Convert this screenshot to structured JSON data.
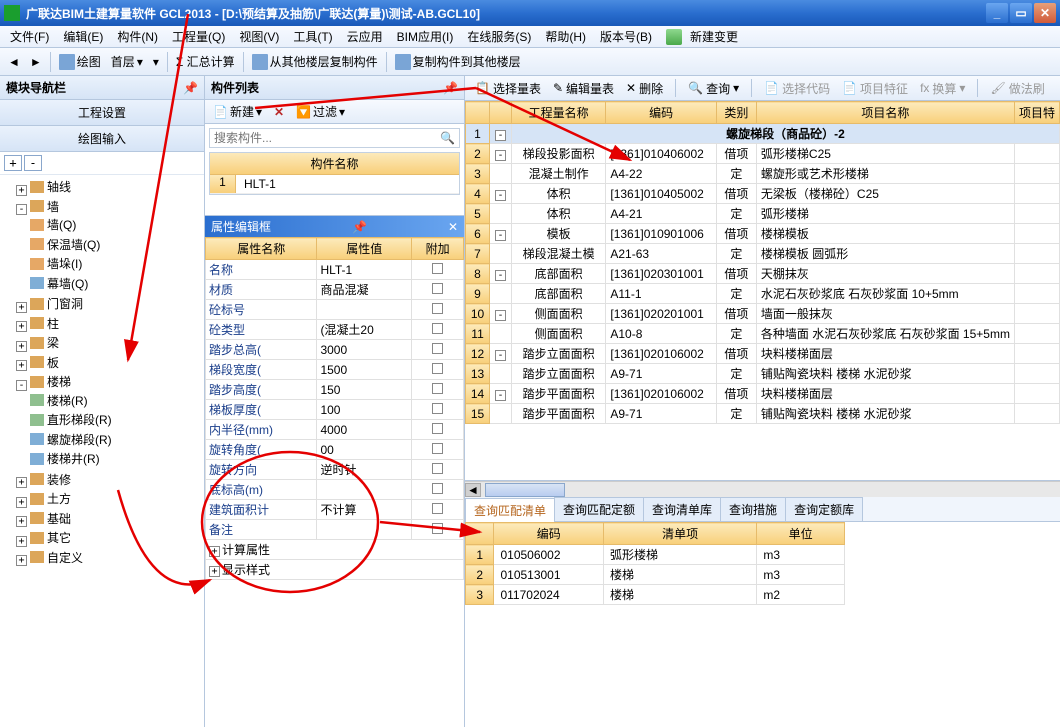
{
  "window": {
    "title": "广联达BIM土建算量软件 GCL2013 - [D:\\预结算及抽筋\\广联达(算量)\\测试-AB.GCL10]"
  },
  "menus": [
    "文件(F)",
    "编辑(E)",
    "构件(N)",
    "工程量(Q)",
    "视图(V)",
    "工具(T)",
    "云应用",
    "BIM应用(I)",
    "在线服务(S)",
    "帮助(H)",
    "版本号(B)"
  ],
  "menu_extra": "新建变更",
  "toolbar": {
    "draw": "绘图",
    "layer": "首层",
    "sum": "Σ 汇总计算",
    "copy_from": "从其他楼层复制构件",
    "copy_to": "复制构件到其他楼层"
  },
  "left": {
    "title": "模块导航栏",
    "acc1": "工程设置",
    "acc2": "绘图输入",
    "tree": {
      "axis": "轴线",
      "wall": "墙",
      "wall_q": "墙(Q)",
      "insu": "保温墙(Q)",
      "pier": "墙垛(I)",
      "curtain": "幕墙(Q)",
      "opening": "门窗洞",
      "col": "柱",
      "beam": "梁",
      "slab": "板",
      "stair": "楼梯",
      "stair_r": "楼梯(R)",
      "straight": "直形梯段(R)",
      "spiral": "螺旋梯段(R)",
      "well": "楼梯井(R)",
      "deco": "装修",
      "earth": "土方",
      "found": "基础",
      "other": "其它",
      "custom": "自定义"
    }
  },
  "mid": {
    "title": "构件列表",
    "new": "新建",
    "filter": "过滤",
    "search_ph": "搜索构件...",
    "col_name": "构件名称",
    "item1": "HLT-1",
    "prop_title": "属性编辑框",
    "prop_cols": {
      "name": "属性名称",
      "val": "属性值",
      "ext": "附加"
    },
    "rows": [
      {
        "n": "名称",
        "v": "HLT-1"
      },
      {
        "n": "材质",
        "v": "商品混凝"
      },
      {
        "n": "砼标号",
        "v": ""
      },
      {
        "n": "砼类型",
        "v": "(混凝土20"
      },
      {
        "n": "踏步总高(",
        "v": "3000"
      },
      {
        "n": "梯段宽度(",
        "v": "1500"
      },
      {
        "n": "踏步高度(",
        "v": "150"
      },
      {
        "n": "梯板厚度(",
        "v": "100"
      },
      {
        "n": "内半径(mm)",
        "v": "4000"
      },
      {
        "n": "旋转角度(",
        "v": "00"
      },
      {
        "n": "旋转方向",
        "v": "逆时针"
      },
      {
        "n": "底标高(m)",
        "v": ""
      },
      {
        "n": "建筑面积计",
        "v": "不计算"
      },
      {
        "n": "备注",
        "v": ""
      }
    ],
    "calc_prop": "计算属性",
    "disp_style": "显示样式"
  },
  "right": {
    "tb": {
      "sel": "选择量表",
      "edit": "编辑量表",
      "del": "删除",
      "query": "查询",
      "code": "选择代码",
      "feat": "项目特征",
      "convert": "换算",
      "brush": "做法刷"
    },
    "cols": {
      "name": "工程量名称",
      "code": "编码",
      "cat": "类别",
      "proj": "项目名称",
      "proj2": "项目特"
    },
    "rows": [
      {
        "n": "1",
        "pm": "-",
        "name": "螺旋梯段（商品砼）-2",
        "hl": true,
        "span": true
      },
      {
        "n": "2",
        "pm": "-",
        "name": "梯段投影面积",
        "code": "[1361]010406002",
        "cat": "借项",
        "proj": "弧形楼梯C25"
      },
      {
        "n": "3",
        "name": "混凝土制作",
        "code": "A4-22",
        "cat": "定",
        "proj": "螺旋形或艺术形楼梯"
      },
      {
        "n": "4",
        "pm": "-",
        "name": "体积",
        "code": "[1361]010405002",
        "cat": "借项",
        "proj": "无梁板（楼梯砼）C25"
      },
      {
        "n": "5",
        "name": "体积",
        "code": "A4-21",
        "cat": "定",
        "proj": "弧形楼梯"
      },
      {
        "n": "6",
        "pm": "-",
        "name": "模板",
        "code": "[1361]010901006",
        "cat": "借项",
        "proj": "楼梯模板"
      },
      {
        "n": "7",
        "name": "梯段混凝土模",
        "code": "A21-63",
        "cat": "定",
        "proj": "楼梯模板 圆弧形"
      },
      {
        "n": "8",
        "pm": "-",
        "name": "底部面积",
        "code": "[1361]020301001",
        "cat": "借项",
        "proj": "天棚抹灰"
      },
      {
        "n": "9",
        "name": "底部面积",
        "code": "A11-1",
        "cat": "定",
        "proj": "水泥石灰砂浆底 石灰砂浆面 10+5mm"
      },
      {
        "n": "10",
        "pm": "-",
        "name": "侧面面积",
        "code": "[1361]020201001",
        "cat": "借项",
        "proj": "墙面一般抹灰"
      },
      {
        "n": "11",
        "name": "侧面面积",
        "code": "A10-8",
        "cat": "定",
        "proj": "各种墙面 水泥石灰砂浆底 石灰砂浆面 15+5mm"
      },
      {
        "n": "12",
        "pm": "-",
        "name": "踏步立面面积",
        "code": "[1361]020106002",
        "cat": "借项",
        "proj": "块料楼梯面层"
      },
      {
        "n": "13",
        "name": "踏步立面面积",
        "code": "A9-71",
        "cat": "定",
        "proj": "铺贴陶瓷块料 楼梯 水泥砂浆"
      },
      {
        "n": "14",
        "pm": "-",
        "name": "踏步平面面积",
        "code": "[1361]020106002",
        "cat": "借项",
        "proj": "块料楼梯面层"
      },
      {
        "n": "15",
        "name": "踏步平面面积",
        "code": "A9-71",
        "cat": "定",
        "proj": "铺贴陶瓷块料 楼梯 水泥砂浆"
      }
    ],
    "btabs": [
      "查询匹配清单",
      "查询匹配定额",
      "查询清单库",
      "查询措施",
      "查询定额库"
    ],
    "mcols": {
      "code": "编码",
      "item": "清单项",
      "unit": "单位"
    },
    "mrows": [
      {
        "n": "1",
        "code": "010506002",
        "item": "弧形楼梯",
        "unit": "m3"
      },
      {
        "n": "2",
        "code": "010513001",
        "item": "楼梯",
        "unit": "m3"
      },
      {
        "n": "3",
        "code": "011702024",
        "item": "楼梯",
        "unit": "m2"
      }
    ]
  }
}
